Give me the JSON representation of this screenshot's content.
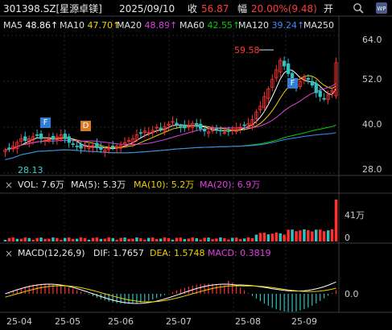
{
  "header": {
    "code": "301398.SZ[星源卓镁]",
    "date": "2025/09/10",
    "close_label": "收",
    "close_value": "56.87",
    "change_label": "幅",
    "change_value": "20.00%(9.48)",
    "open_label": "开",
    "icon_names": [
      "search-icon",
      "settings-icon"
    ]
  },
  "ma_legend": [
    {
      "label": "MA5",
      "value": "48.86↑",
      "color": "#ffffff"
    },
    {
      "label": "MA10",
      "value": "47.70↑",
      "color": "#f0d000"
    },
    {
      "label": "MA20",
      "value": "48.89↑",
      "color": "#e040e0"
    },
    {
      "label": "MA60",
      "value": "42.55↑",
      "color": "#00d000"
    },
    {
      "label": "MA120",
      "value": "39.24↑",
      "color": "#4488ff"
    },
    {
      "label": "MA250",
      "value": "",
      "color": "#dddddd"
    }
  ],
  "price_axis": [
    "64.0",
    "52.0",
    "40.0",
    "28.0"
  ],
  "annotations": {
    "high": "59.58",
    "low": "28.13",
    "markers": [
      "F",
      "D",
      "F"
    ]
  },
  "vol_legend": {
    "close_icon": "×",
    "vol": "VOL: 7.6万",
    "ma5": "MA(5): 5.3万",
    "ma10": "MA(10): 5.2万",
    "ma20": "MA(20): 6.9万"
  },
  "vol_axis": [
    "41万",
    "0"
  ],
  "macd_legend": {
    "close_icon": "×",
    "title": "MACD(12,26,9)",
    "dif": "DIF: 1.7657",
    "dea": "DEA: 1.5748",
    "macd": "MACD: 0.3819"
  },
  "macd_axis": [
    "0.0"
  ],
  "x_axis": [
    "25-04",
    "25-05",
    "25-06",
    "25-07",
    "25-08",
    "25-09"
  ],
  "colors": {
    "up": "#ff3030",
    "down": "#30c0c0",
    "background": "#000000",
    "grid": "#333333"
  },
  "chart_data": {
    "type": "candlestick",
    "price_ylim": [
      28,
      64
    ],
    "closes_approx": [
      34,
      34.5,
      35,
      36,
      37,
      36.5,
      37,
      37.5,
      38,
      37,
      36.5,
      37,
      36.8,
      37.5,
      38,
      37,
      36,
      35.5,
      35,
      34.5,
      35,
      34.8,
      35.2,
      34.6,
      34.2,
      34,
      34.5,
      34.8,
      35,
      35.2,
      36,
      36.5,
      37,
      38,
      38.5,
      39,
      38.6,
      39.2,
      40,
      39.5,
      40.2,
      40.8,
      41.5,
      40.6,
      40,
      39.8,
      40.5,
      41,
      40.2,
      39.6,
      39,
      38.8,
      39.2,
      39.6,
      39,
      38.6,
      39,
      39.4,
      39.8,
      40,
      40.5,
      41,
      42,
      44,
      45.5,
      48,
      50,
      52.5,
      55,
      57.5,
      56,
      54,
      52,
      50.5,
      52,
      53,
      52.5,
      51,
      49,
      48,
      47.5,
      48.5,
      49.5,
      56.87
    ]
  }
}
